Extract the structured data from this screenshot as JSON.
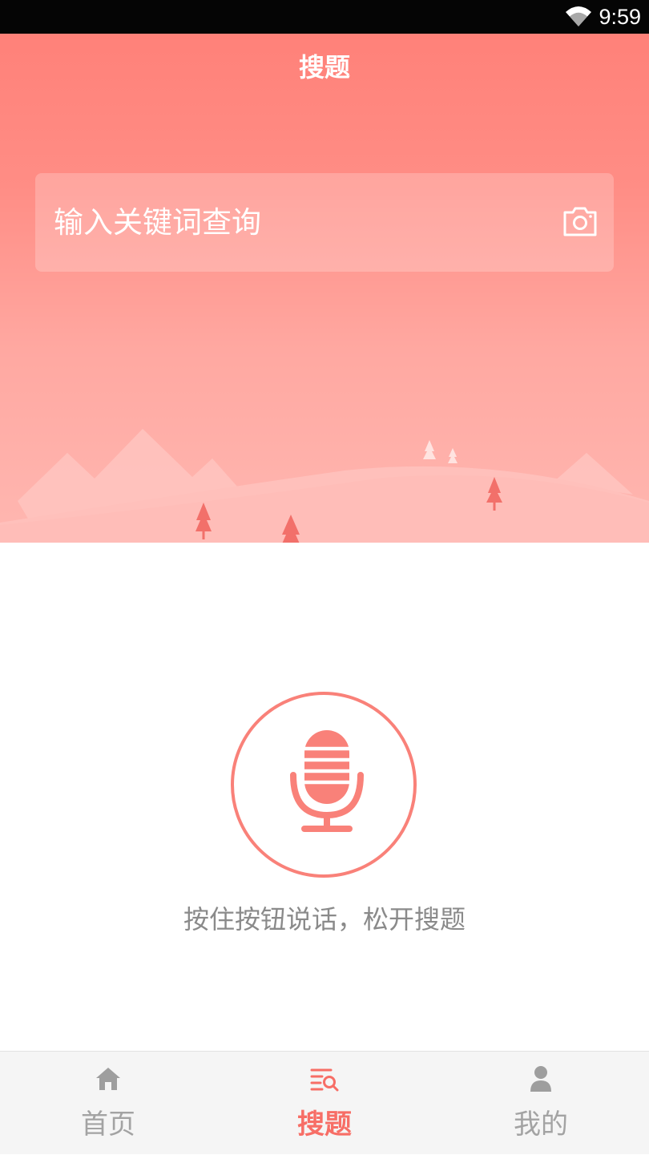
{
  "status_bar": {
    "time": "9:59",
    "wifi_icon": "wifi-icon"
  },
  "header": {
    "title": "搜题"
  },
  "search": {
    "placeholder": "输入关键词查询",
    "camera_icon": "camera-icon"
  },
  "voice": {
    "hint": "按住按钮说话，松开搜题",
    "mic_icon": "microphone-icon"
  },
  "tabbar": {
    "items": [
      {
        "label": "首页",
        "icon": "home-icon",
        "active": false
      },
      {
        "label": "搜题",
        "icon": "search-list-icon",
        "active": true
      },
      {
        "label": "我的",
        "icon": "user-icon",
        "active": false
      }
    ]
  },
  "colors": {
    "accent": "#f76e66",
    "header_top": "#ff8179",
    "header_bottom": "#ffb7b1",
    "tab_inactive": "#a3a3a3",
    "hint_text": "#8a8a8a"
  }
}
